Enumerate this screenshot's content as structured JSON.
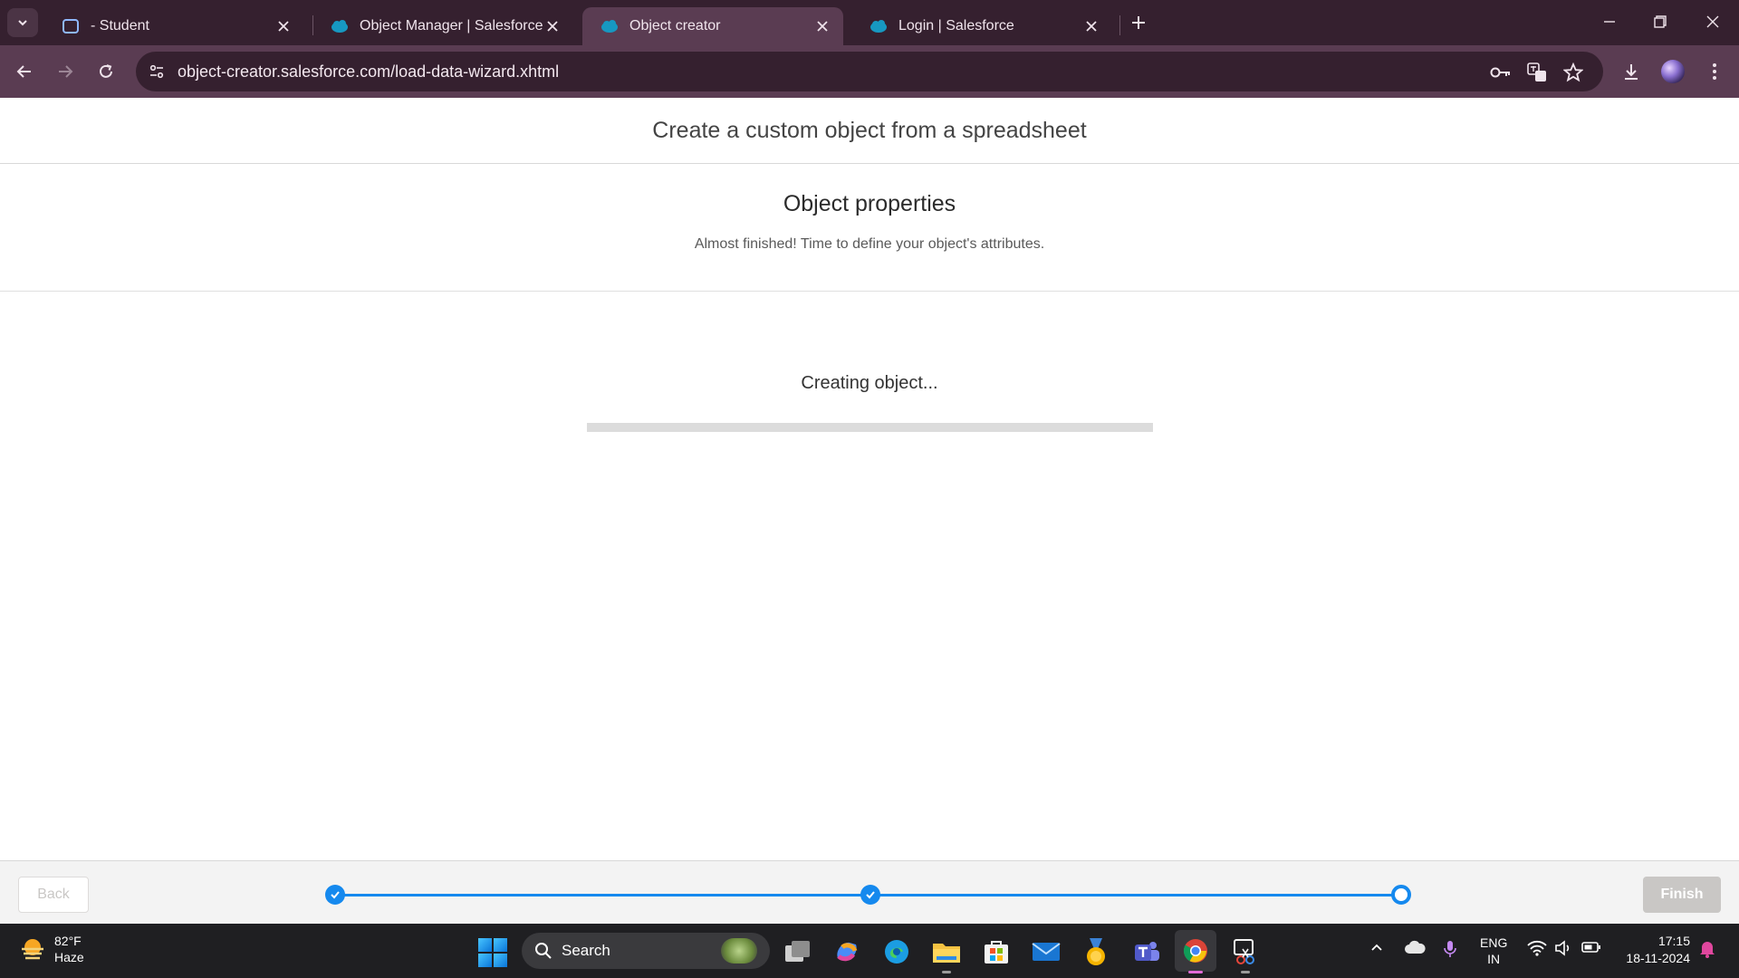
{
  "browser": {
    "tabs": [
      {
        "title": "- Student",
        "active": false
      },
      {
        "title": "Object Manager | Salesforce",
        "active": false
      },
      {
        "title": "Object creator",
        "active": true
      },
      {
        "title": "Login | Salesforce",
        "active": false
      }
    ],
    "url": "object-creator.salesforce.com/load-data-wizard.xhtml"
  },
  "page": {
    "header_title": "Create a custom object from a spreadsheet",
    "section_title": "Object properties",
    "section_subtitle": "Almost finished! Time to define your object's attributes.",
    "status_text": "Creating object...",
    "progress_fraction": 0
  },
  "wizard": {
    "back_label": "Back",
    "finish_label": "Finish",
    "steps": [
      {
        "state": "complete"
      },
      {
        "state": "complete"
      },
      {
        "state": "current"
      }
    ]
  },
  "taskbar": {
    "weather_temp": "82°F",
    "weather_desc": "Haze",
    "search_label": "Search",
    "lang_line1": "ENG",
    "lang_line2": "IN",
    "time": "17:15",
    "date": "18-11-2024"
  },
  "colors": {
    "accent": "#1589ee",
    "chrome_dark": "#35202f",
    "chrome_toolbar": "#5a3c52"
  }
}
